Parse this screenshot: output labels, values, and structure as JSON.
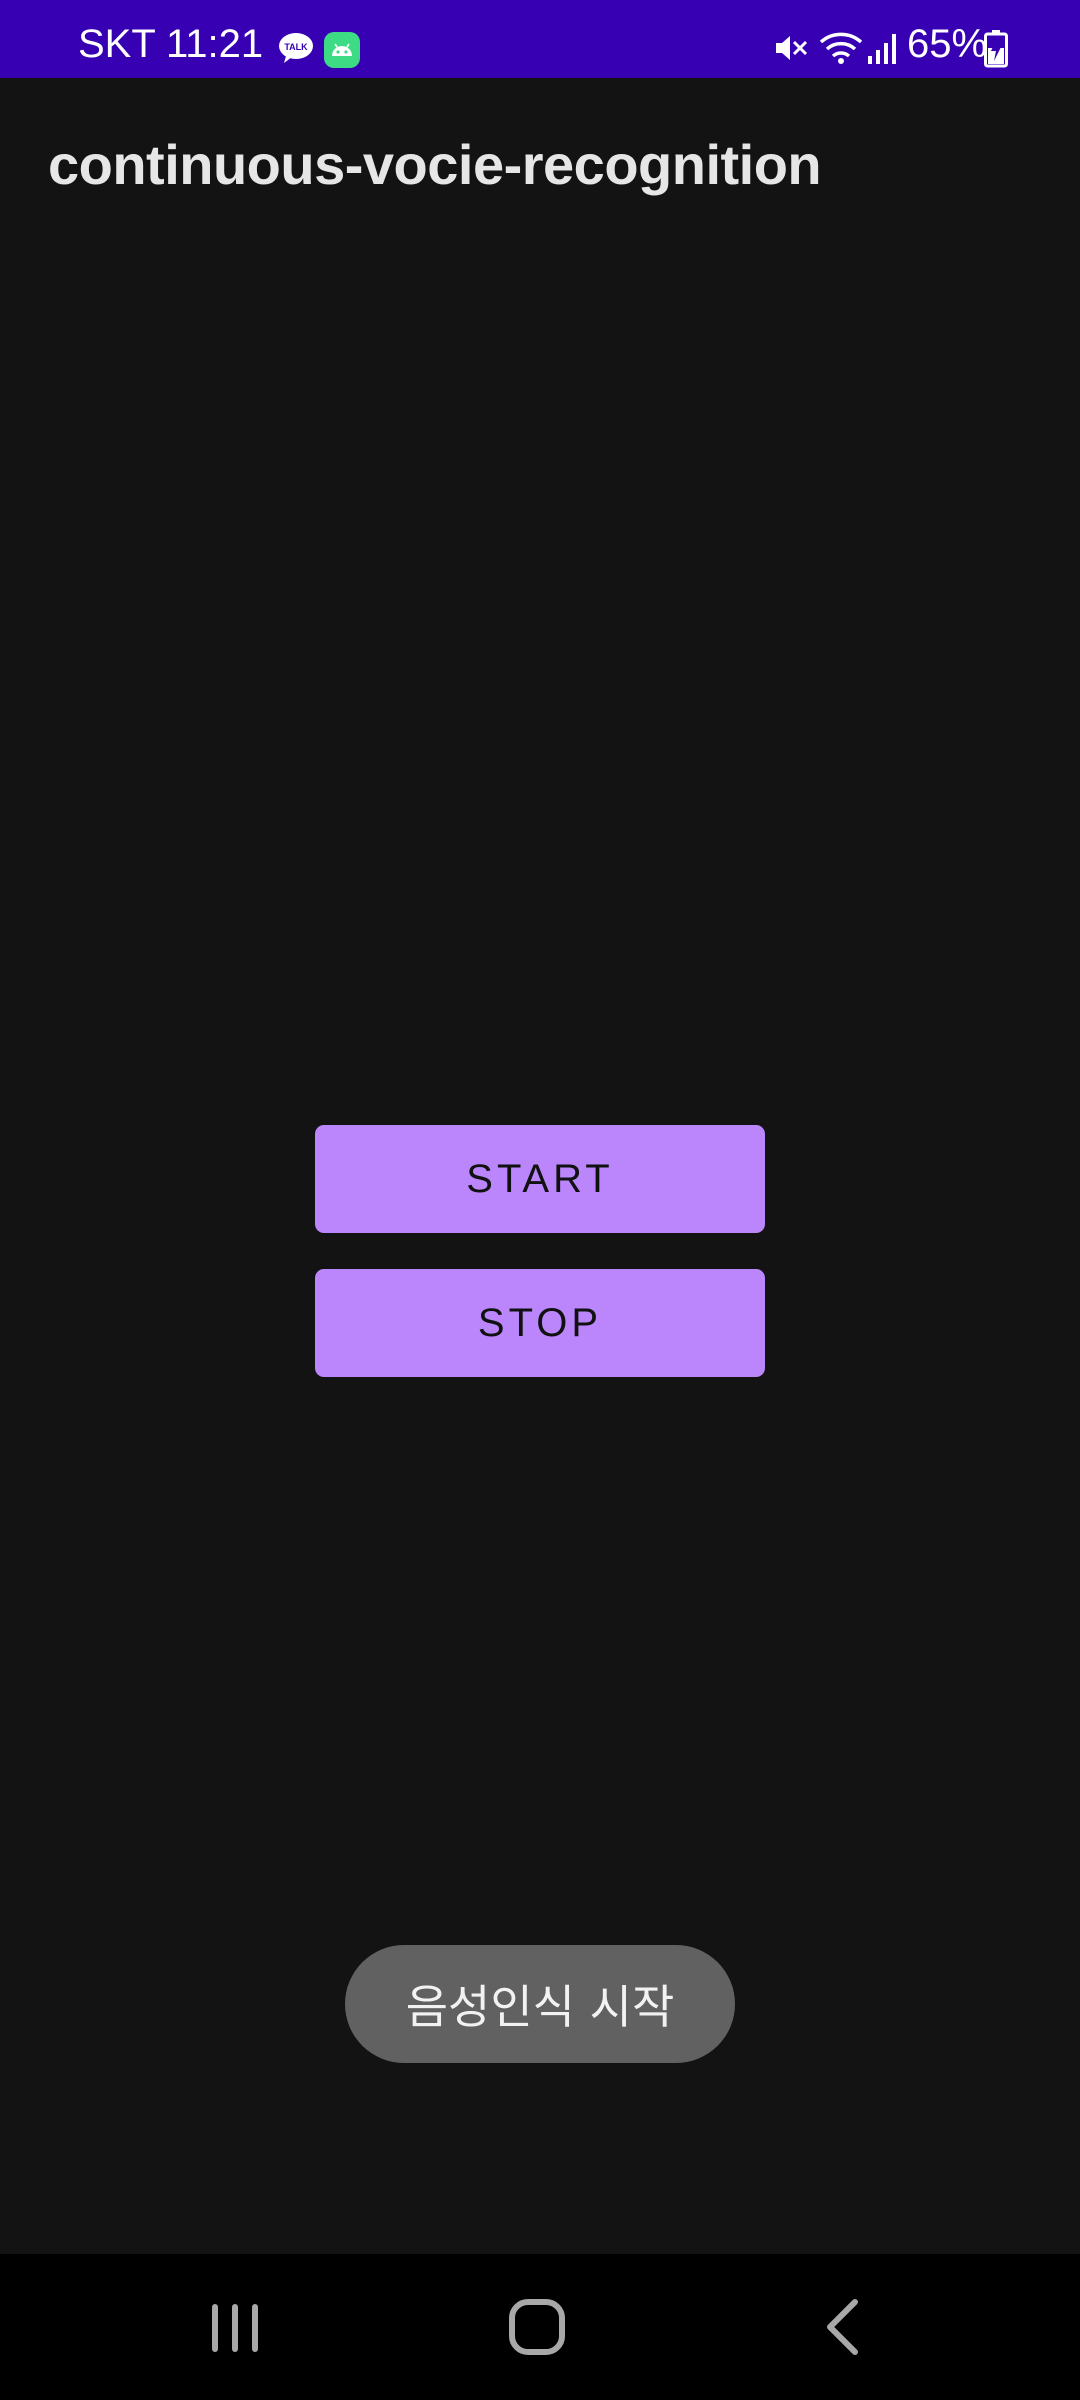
{
  "status_bar": {
    "carrier": "SKT",
    "time": "11:21",
    "battery": "65%",
    "talk_badge": "TALK",
    "colors": {
      "background": "#3700b3",
      "text": "#ffffff"
    },
    "icons": [
      "talk-icon",
      "android-icon",
      "mute-icon",
      "wifi-icon",
      "signal-icon",
      "battery-charging-icon"
    ]
  },
  "app": {
    "title": "continuous-vocie-recognition",
    "background": "#131313"
  },
  "buttons": {
    "start_label": "START",
    "stop_label": "STOP",
    "color": "#bb86fc"
  },
  "toast": {
    "message": "음성인식 시작"
  },
  "nav_bar": {
    "icons": [
      "recents-icon",
      "home-icon",
      "back-icon"
    ]
  }
}
